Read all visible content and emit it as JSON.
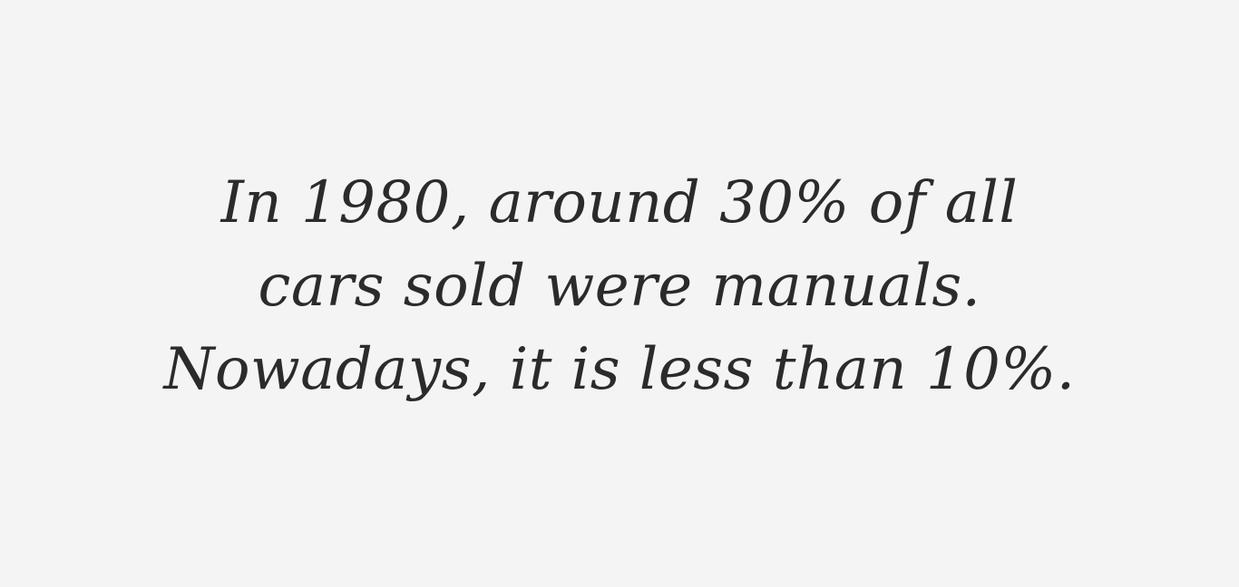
{
  "quote": {
    "lines": [
      "In 1980, around 30% of all",
      "cars sold were manuals.",
      "Nowadays, it is less than 10%."
    ]
  }
}
